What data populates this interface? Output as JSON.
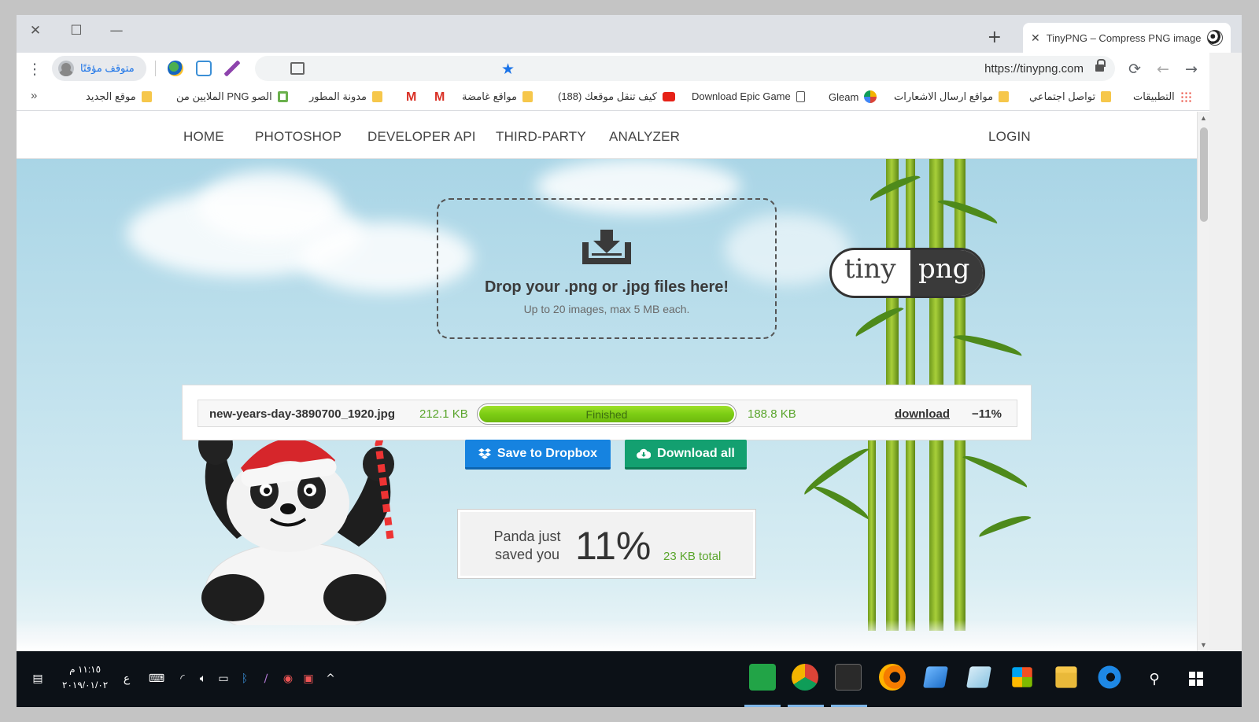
{
  "browser": {
    "tab": {
      "title": "TinyPNG – Compress PNG image",
      "close": "✕"
    },
    "new_tab": "+",
    "window_controls": {
      "close": "✕",
      "maximize": "☐",
      "minimize": "—"
    },
    "url": "https://tinypng.com",
    "profile_label": "متوقف مؤقتًا",
    "bookmarks": [
      {
        "label": "التطبيقات",
        "icon": "apps-grid-icon"
      },
      {
        "label": "تواصل اجتماعي",
        "icon": "folder-icon"
      },
      {
        "label": "مواقع ارسال الاشعارات",
        "icon": "folder-icon"
      },
      {
        "label": "Gleam",
        "icon": "gleam-icon"
      },
      {
        "label": "Download Epic Game",
        "icon": "page-icon"
      },
      {
        "label": "(188) كيف تنقل موقعك",
        "icon": "youtube-icon"
      },
      {
        "label": "مواقع غامضة",
        "icon": "folder-icon"
      },
      {
        "label": "",
        "icon": "gmail-icon"
      },
      {
        "label": "",
        "icon": "gmail-icon"
      },
      {
        "label": "مدونة المطور",
        "icon": "folder-icon"
      },
      {
        "label": "الملايين من PNG الصو",
        "icon": "green-square-icon"
      },
      {
        "label": "موقع الجديد",
        "icon": "folder-icon"
      }
    ],
    "bookmarks_overflow": "»"
  },
  "site": {
    "nav": {
      "home": "HOME",
      "photoshop": "PHOTOSHOP",
      "developer_api": "DEVELOPER API",
      "third_party": "THIRD-PARTY",
      "analyzer": "ANALYZER",
      "login": "LOGIN"
    },
    "dropzone": {
      "title": "Drop your .png or .jpg files here!",
      "subtitle": "Up to 20 images, max 5 MB each."
    },
    "logo": {
      "left": "tiny",
      "right": "png"
    },
    "result": {
      "filename": "new-years-day-3890700_1920.jpg",
      "original_size": "212.1 KB",
      "status": "Finished",
      "progress": 1.0,
      "compressed_size": "188.8 KB",
      "download": "download",
      "reduction": "−11%"
    },
    "buttons": {
      "dropbox": "Save to Dropbox",
      "download_all": "Download all"
    },
    "savings": {
      "line1": "Panda just",
      "line2": "saved you",
      "percent": "11%",
      "total": "23 KB total"
    }
  },
  "taskbar": {
    "time": "١١:١٥ م",
    "date": "٢٠١٩/٠١/٠٢",
    "language": "ع"
  },
  "colors": {
    "accent_green": "#5aa52c",
    "dropbox_blue": "#1683e0",
    "download_green": "#13a070",
    "sky": "#a9d5e6"
  }
}
